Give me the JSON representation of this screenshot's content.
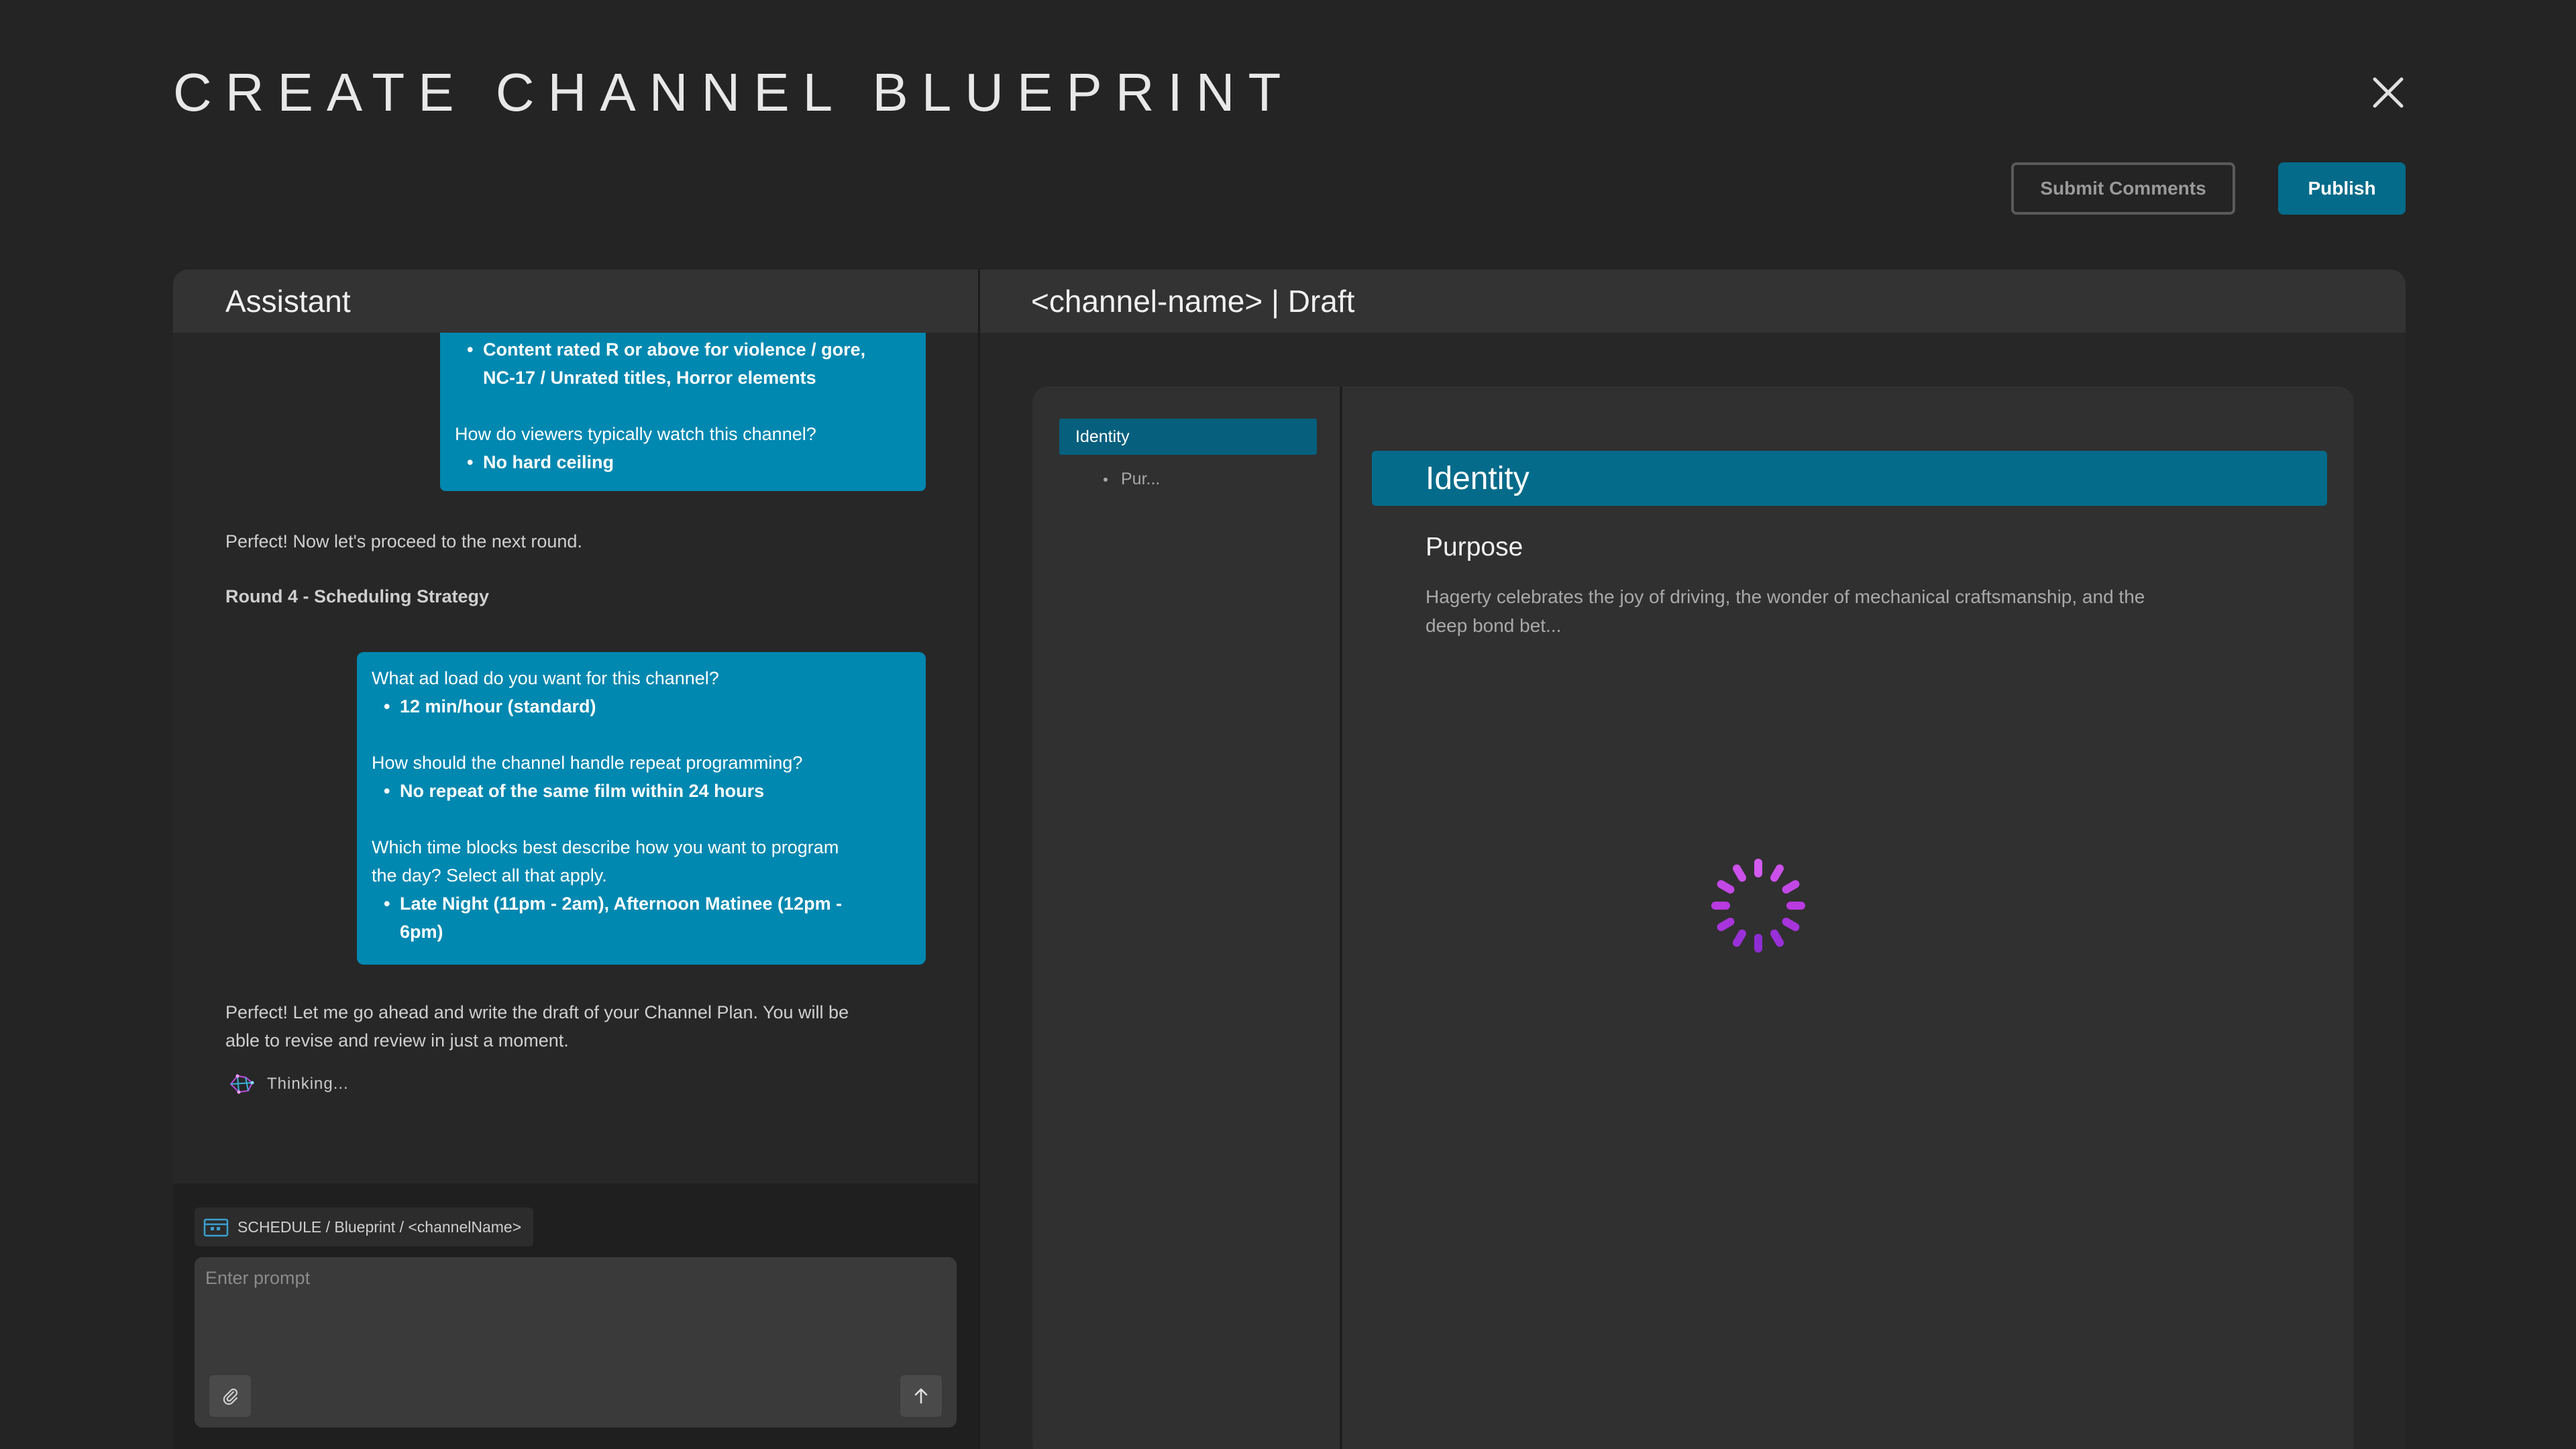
{
  "page": {
    "title": "CREATE CHANNEL BLUEPRINT",
    "close_icon": "close-icon"
  },
  "actions": {
    "submit_comments": "Submit Comments",
    "publish": "Publish"
  },
  "colors": {
    "background": "#242424",
    "accent": "#046b8a",
    "bubble": "#0188b0",
    "spinner": "#b83ae0"
  },
  "assistant": {
    "header": "Assistant",
    "bubble1": {
      "bullet1_line1": "Content rated R or above for violence / gore,",
      "bullet1_line2": "NC-17 / Unrated titles, Horror elements",
      "question2": "How do viewers typically watch this channel?",
      "answer2": "No hard ceiling"
    },
    "message1": "Perfect! Now let's proceed to the next round.",
    "round_label": "Round 4 - Scheduling Strategy",
    "bubble2": {
      "q1": "What ad load do you want for this channel?",
      "a1": "12 min/hour (standard)",
      "q2": "How should the channel handle repeat programming?",
      "a2": "No repeat of the same film within 24 hours",
      "q3_line1": "Which time blocks best describe how you want to program",
      "q3_line2": "the day? Select all that apply.",
      "a3_line1": "Late Night (11pm - 2am), Afternoon Matinee (12pm -",
      "a3_line2": "6pm)"
    },
    "message2_line1": "Perfect! Let me go ahead and write the draft of your Channel Plan. You will be",
    "message2_line2": "able to revise and review in just a moment.",
    "thinking": "Thinking...",
    "context_path": "SCHEDULE / Blueprint / <channelName>",
    "prompt_placeholder": "Enter prompt"
  },
  "draft": {
    "header": "<channel-name> | Draft",
    "nav_active": "Identity",
    "nav_sub": "Pur...",
    "section_title": "Identity",
    "subsection_title": "Purpose",
    "body_line1": "Hagerty celebrates the joy of driving, the wonder of mechanical craftsmanship, and the",
    "body_line2": "deep bond bet..."
  }
}
